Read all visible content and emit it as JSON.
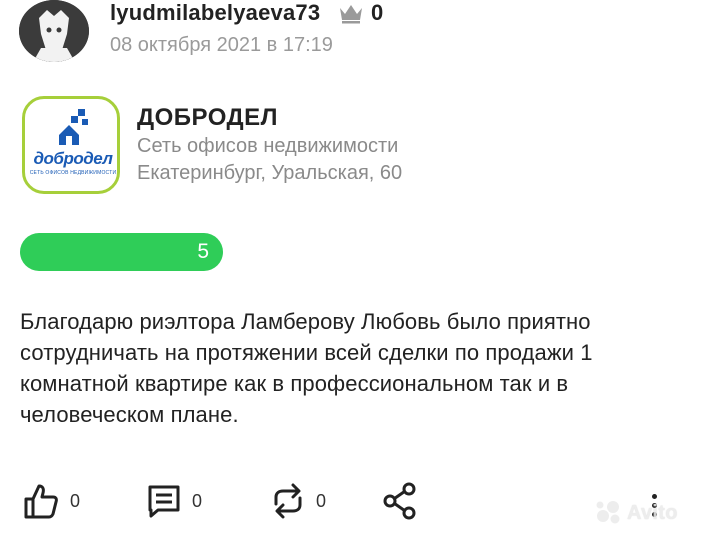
{
  "author": {
    "username": "lyudmilabelyaeva73",
    "crown_count": "0",
    "date": "08 октября 2021 в 17:19"
  },
  "organization": {
    "logo_word": "добродел",
    "logo_sub": "СЕТЬ ОФИСОВ НЕДВИЖИМОСТИ",
    "name": "ДОБРОДЕЛ",
    "type": "Сеть офисов недвижимости",
    "address": "Екатеринбург, Уральская, 60"
  },
  "rating": {
    "value": "5",
    "color": "#2fcd58"
  },
  "review": {
    "text": "Благодарю риэлтора Ламберову Любовь было приятно сотрудничать на протяжении всей сделки по продажи 1 комнатной квартире как в профессиональном так и в человеческом плане."
  },
  "actions": {
    "likes": "0",
    "comments": "0",
    "reposts": "0"
  },
  "watermark": {
    "text": "Avito"
  },
  "icons": [
    "avatar",
    "crown-icon",
    "like-icon",
    "comment-icon",
    "repost-icon",
    "share-icon",
    "more-icon",
    "avito-logo-icon"
  ]
}
